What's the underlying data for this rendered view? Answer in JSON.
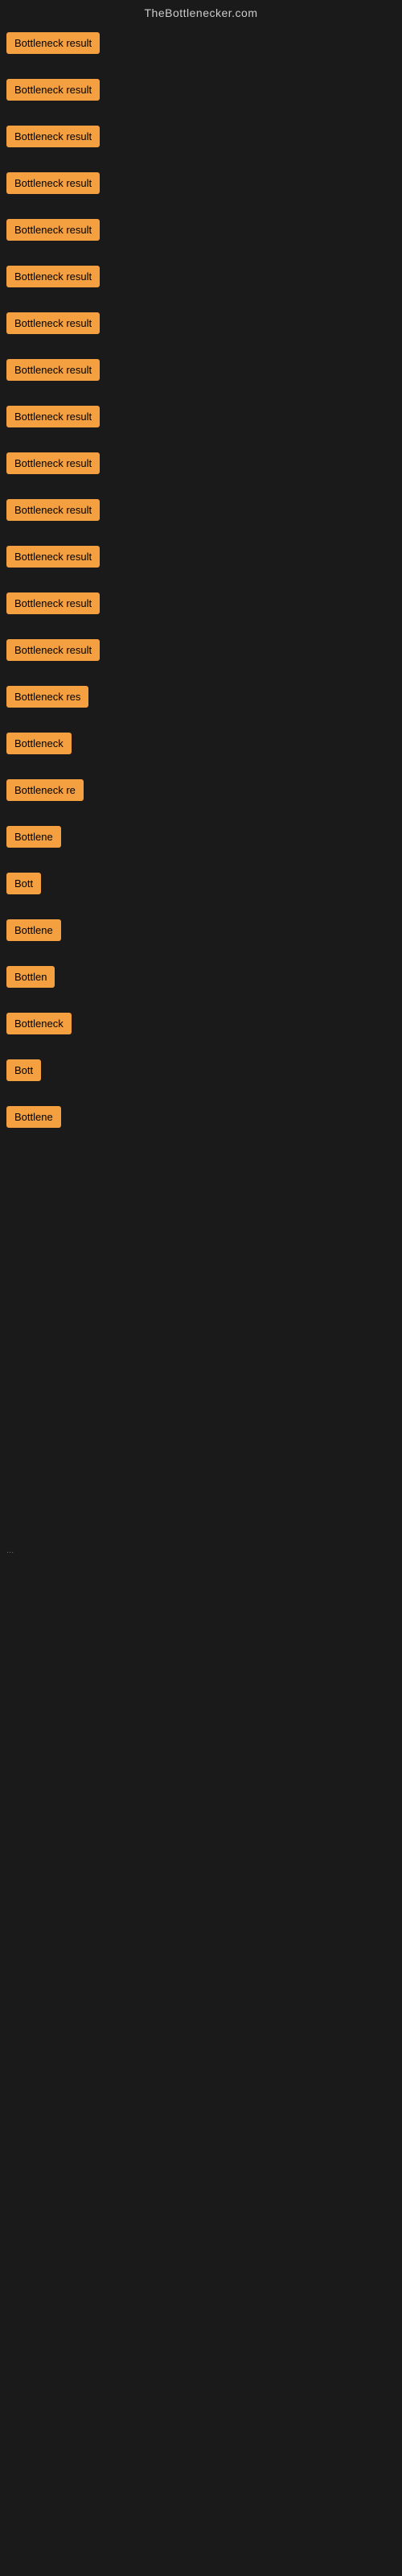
{
  "header": {
    "title": "TheBottlenecker.com"
  },
  "items": [
    {
      "id": 1,
      "label": "Bottleneck result",
      "size_class": "item-full",
      "spacer_after": true
    },
    {
      "id": 2,
      "label": "Bottleneck result",
      "size_class": "item-full",
      "spacer_after": true
    },
    {
      "id": 3,
      "label": "Bottleneck result",
      "size_class": "item-full",
      "spacer_after": true
    },
    {
      "id": 4,
      "label": "Bottleneck result",
      "size_class": "item-full",
      "spacer_after": true
    },
    {
      "id": 5,
      "label": "Bottleneck result",
      "size_class": "item-full",
      "spacer_after": true
    },
    {
      "id": 6,
      "label": "Bottleneck result",
      "size_class": "item-full",
      "spacer_after": true
    },
    {
      "id": 7,
      "label": "Bottleneck result",
      "size_class": "item-full",
      "spacer_after": true
    },
    {
      "id": 8,
      "label": "Bottleneck result",
      "size_class": "item-full",
      "spacer_after": true
    },
    {
      "id": 9,
      "label": "Bottleneck result",
      "size_class": "item-full",
      "spacer_after": true
    },
    {
      "id": 10,
      "label": "Bottleneck result",
      "size_class": "item-full",
      "spacer_after": true
    },
    {
      "id": 11,
      "label": "Bottleneck result",
      "size_class": "item-full",
      "spacer_after": true
    },
    {
      "id": 12,
      "label": "Bottleneck result",
      "size_class": "item-full",
      "spacer_after": true
    },
    {
      "id": 13,
      "label": "Bottleneck result",
      "size_class": "item-full",
      "spacer_after": true
    },
    {
      "id": 14,
      "label": "Bottleneck result",
      "size_class": "item-full",
      "spacer_after": true
    },
    {
      "id": 15,
      "label": "Bottleneck res",
      "size_class": "item-partial-1",
      "spacer_after": true
    },
    {
      "id": 16,
      "label": "Bottleneck",
      "size_class": "item-partial-2",
      "spacer_after": true
    },
    {
      "id": 17,
      "label": "Bottleneck re",
      "size_class": "item-partial-1",
      "spacer_after": true
    },
    {
      "id": 18,
      "label": "Bottlene",
      "size_class": "item-partial-3",
      "spacer_after": true
    },
    {
      "id": 19,
      "label": "Bott",
      "size_class": "item-partial-7",
      "spacer_after": true
    },
    {
      "id": 20,
      "label": "Bottlene",
      "size_class": "item-partial-3",
      "spacer_after": true
    },
    {
      "id": 21,
      "label": "Bottlen",
      "size_class": "item-partial-9",
      "spacer_after": true
    },
    {
      "id": 22,
      "label": "Bottleneck",
      "size_class": "item-partial-2",
      "spacer_after": true
    },
    {
      "id": 23,
      "label": "Bott",
      "size_class": "item-partial-7",
      "spacer_after": true
    },
    {
      "id": 24,
      "label": "Bottlene",
      "size_class": "item-partial-3",
      "spacer_after": true
    }
  ],
  "dots": {
    "label": "..."
  }
}
